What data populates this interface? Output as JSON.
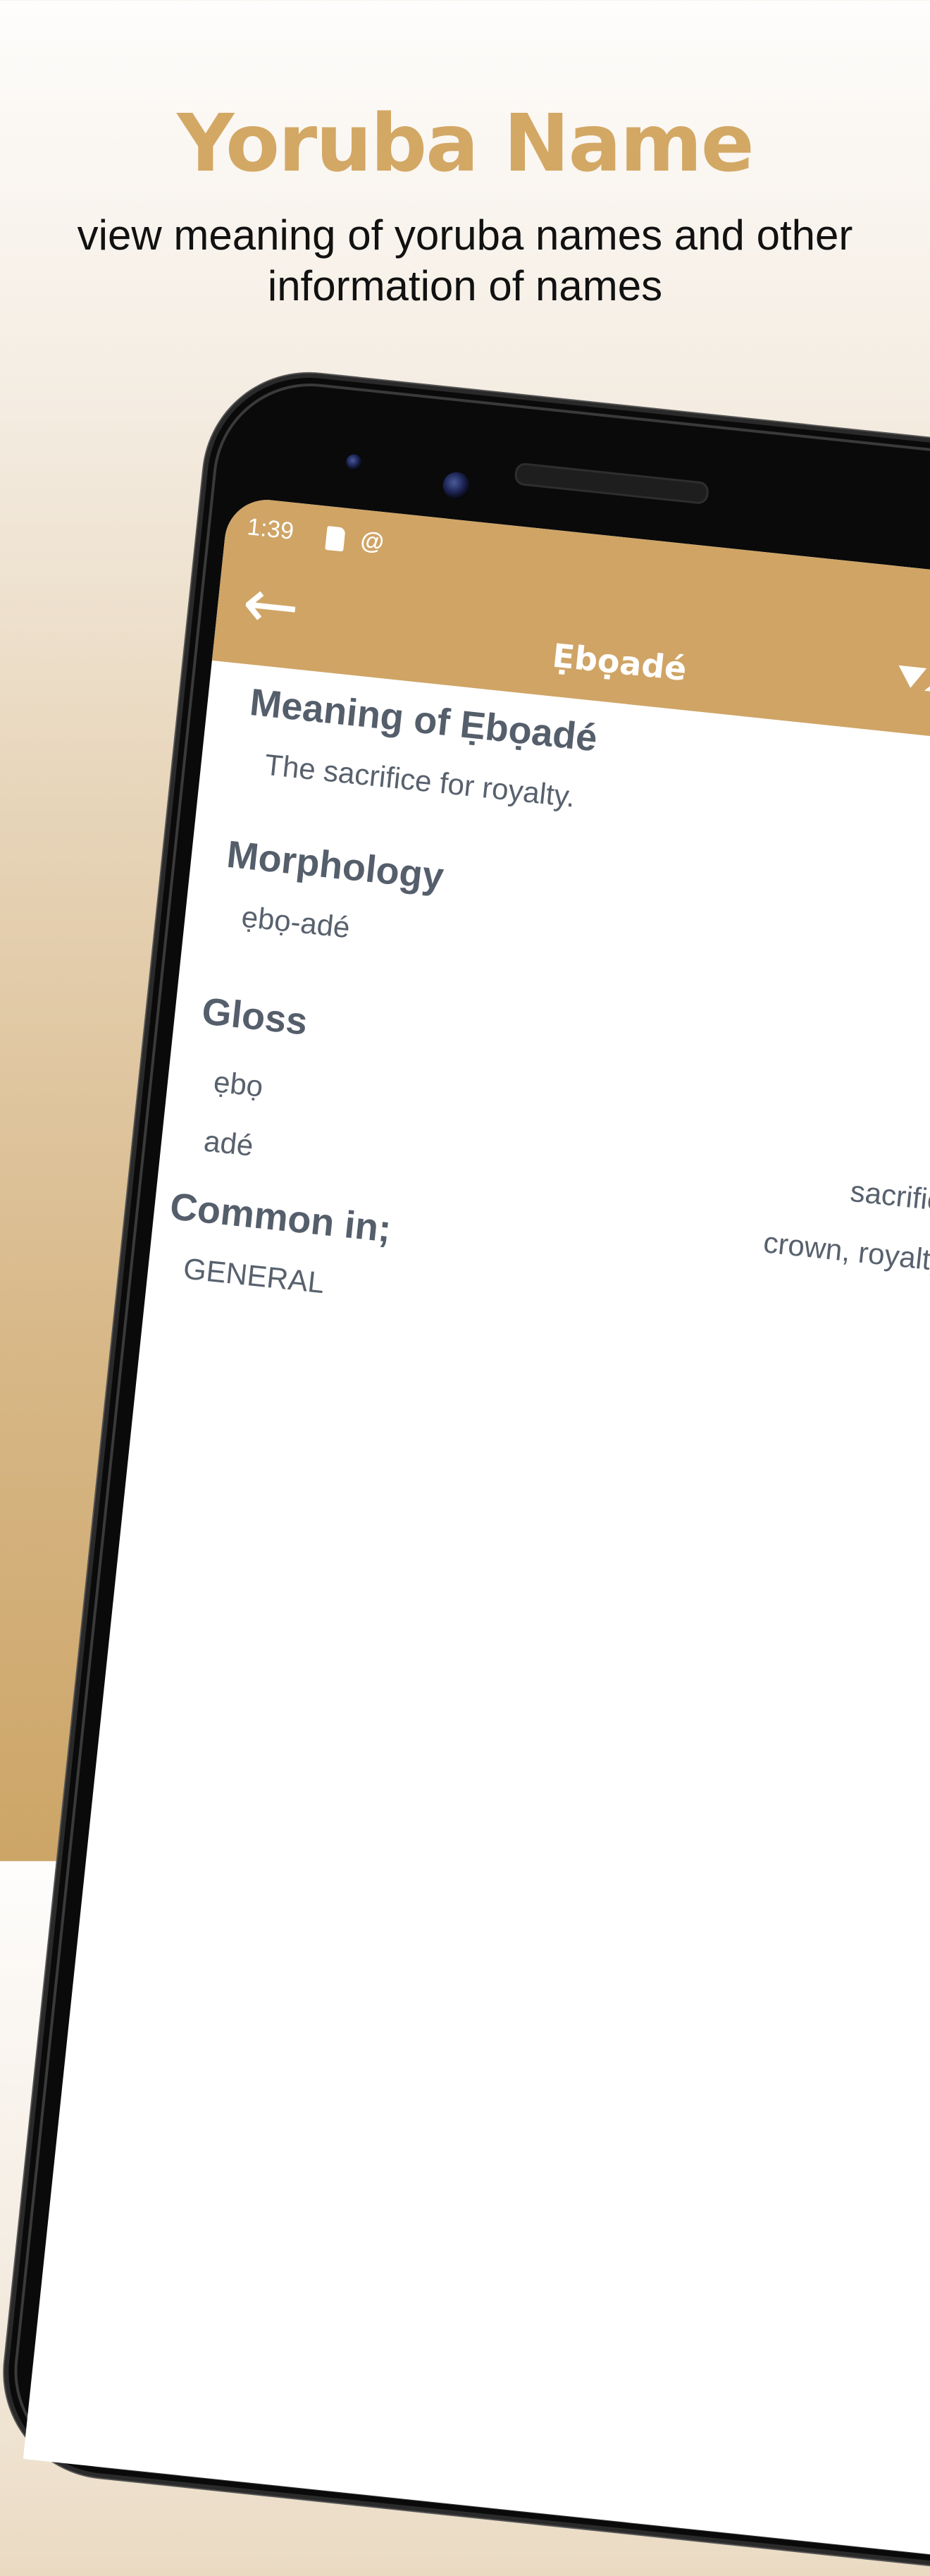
{
  "promo": {
    "title": "Yoruba Name",
    "subtitle": "view meaning of yoruba names and other information of names"
  },
  "status_bar": {
    "time": "1:39",
    "icons": [
      "sd-card-icon",
      "at-sign-icon",
      "wifi-icon",
      "signal-icon"
    ]
  },
  "app_bar": {
    "back_icon": "arrow-left-icon",
    "title": "Ẹbọadé",
    "background": "#cfa465"
  },
  "name_detail": {
    "meaning_heading": "Meaning of Ẹbọadé",
    "meaning_text": "The sacrifice for royalty.",
    "morphology_heading": "Morphology",
    "morphology_text": "ẹbọ-adé",
    "gloss_heading": "Gloss",
    "gloss_terms": [
      {
        "term": "ẹbọ",
        "definition": "sacrifice"
      },
      {
        "term": "adé",
        "definition": "crown, royalty"
      }
    ],
    "common_heading": "Common in;",
    "common_text": "GENERAL"
  },
  "colors": {
    "accent": "#d3a865",
    "app_bar": "#cfa465",
    "heading_text": "#555e6b",
    "body_text": "#58616d"
  }
}
